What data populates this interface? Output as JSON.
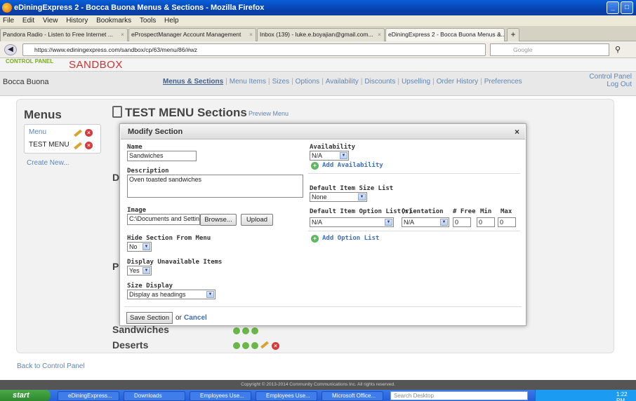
{
  "window": {
    "title": "eDiningExpress 2 - Bocca Buona Menus & Sections - Mozilla Firefox"
  },
  "menubar": [
    "File",
    "Edit",
    "View",
    "History",
    "Bookmarks",
    "Tools",
    "Help"
  ],
  "tabs": [
    {
      "label": "Pandora Radio - Listen to Free Internet ..."
    },
    {
      "label": "eProspectManager Account Management"
    },
    {
      "label": "Inbox (139) - luke.e.boyajian@gmail.com..."
    },
    {
      "label": "eDiningExpress 2 - Bocca Buona Menus &..."
    }
  ],
  "new_tab": "+",
  "url": "https://www.ediningexpress.com/sandbox/cp/63/menu/86/#wz",
  "search_placeholder": "Google",
  "header": {
    "logo_text": "CONTROL PANEL",
    "sandbox": "SANDBOX",
    "business": "Bocca Buona"
  },
  "nav": {
    "links": [
      "Menus & Sections",
      "Menu Items",
      "Sizes",
      "Options",
      "Availability",
      "Discounts",
      "Upselling",
      "Order History",
      "Preferences"
    ],
    "control_panel": "Control Panel",
    "log_out": "Log Out"
  },
  "menus_panel": {
    "title": "Menus",
    "items": [
      "Menu",
      "TEST MENU"
    ],
    "create_new": "Create New..."
  },
  "sections": {
    "title": "TEST MENU Sections",
    "preview": "Preview Menu",
    "bg_letters": [
      "D",
      "P"
    ],
    "rows": [
      "Sandwiches",
      "Deserts"
    ]
  },
  "footer": {
    "back": "Back to Control Panel",
    "copyright": "Copyright © 2013-2014 Community Communications Inc. All rights reserved."
  },
  "modal": {
    "title": "Modify Section",
    "close": "×",
    "name_label": "Name",
    "name_value": "Sandwiches",
    "description_label": "Description",
    "description_value": "Oven toasted sandwiches",
    "image_label": "Image",
    "image_value": "C:\\Documents and Settin",
    "browse": "Browse...",
    "upload": "Upload",
    "hide_label": "Hide Section From Menu",
    "hide_value": "No",
    "display_unavail_label": "Display Unavailable Items",
    "display_unavail_value": "Yes",
    "size_display_label": "Size Display",
    "size_display_value": "Display as headings",
    "availability_label": "Availability",
    "availability_value": "N/A",
    "add_availability": "Add Availability",
    "default_size_label": "Default Item Size List",
    "default_size_value": "None",
    "default_option_label": "Default Item Option List(s)",
    "orientation_label": "Orientation",
    "free_label": "# Free",
    "min_label": "Min",
    "max_label": "Max",
    "option_list_value": "N/A",
    "orientation_value": "N/A",
    "free_value": "0",
    "min_value": "0",
    "max_value": "0",
    "add_option_list": "Add Option List",
    "save": "Save Section",
    "or": "or",
    "cancel": "Cancel"
  },
  "taskbar": {
    "start": "start",
    "tasks": [
      "eDiningExpress...",
      "Downloads",
      "Employees Use...",
      "Employees Use...",
      "Microsoft Office..."
    ],
    "search": "Search Desktop",
    "clock": "1:22 PM"
  }
}
